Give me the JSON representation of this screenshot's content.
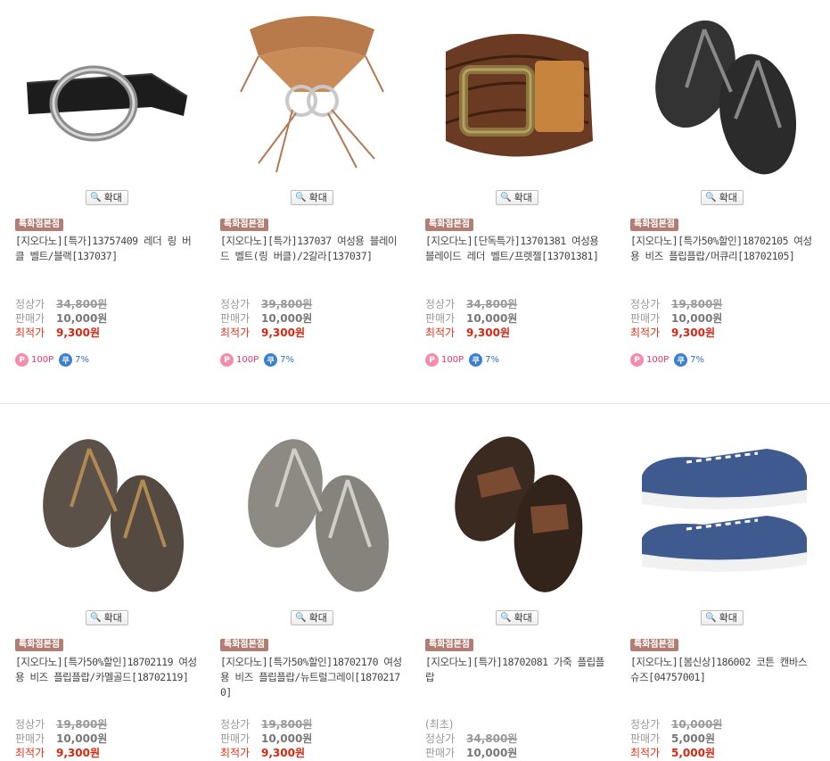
{
  "colors": {
    "badge_bg": "#b27d72",
    "best_price": "#d52711",
    "point": "#f48cac",
    "coupon": "#3b7fd0"
  },
  "labels": {
    "zoom": "확대",
    "regular_price": "정상가",
    "sale_price": "판매가",
    "best_price": "최적가",
    "store_badge": "특화점본점"
  },
  "products": [
    {
      "image": "black-oval-buckle-belt",
      "name": "[지오다노][특가]13757409 레더 링 버클 벨트/블랙[137037]",
      "note": "",
      "regular": "34,800원",
      "sale": "10,000원",
      "best": "9,300원",
      "point": "100P",
      "coupon": "7%"
    },
    {
      "image": "braided-ring-belt-tan",
      "name": "[지오다노][특가]137037 여성용 블레이드 벨트(링 버클)/2갈라[137037]",
      "note": "",
      "regular": "39,800원",
      "sale": "10,000원",
      "best": "9,300원",
      "point": "100P",
      "coupon": "7%"
    },
    {
      "image": "braided-leather-belt-brown",
      "name": "[지오다노][단독특가]13701381 여성용 블레이드 레더 벨트/프렛젤[13701381]",
      "note": "",
      "regular": "34,800원",
      "sale": "10,000원",
      "best": "9,300원",
      "point": "100P",
      "coupon": "7%"
    },
    {
      "image": "mercury-beads-flip-flop",
      "name": "[지오다노][특가50%할인]18702105 여성용 비즈 플립플랍/머큐리[18702105]",
      "note": "",
      "regular": "19,800원",
      "sale": "10,000원",
      "best": "9,300원",
      "point": "100P",
      "coupon": "7%"
    },
    {
      "image": "caramel-gold-beads-flip-flop",
      "name": "[지오다노][특가50%할인]18702119 여성용 비즈 플립플랍/카멜골드[18702119]",
      "note": "",
      "regular": "19,800원",
      "sale": "10,000원",
      "best": "9,300원"
    },
    {
      "image": "neutral-gray-beads-flip-flop",
      "name": "[지오다노][특가50%할인]18702170 여성용 비즈 플립플랍/뉴트럴그레이[18702170]",
      "note": "",
      "regular": "19,800원",
      "sale": "10,000원",
      "best": "9,300원"
    },
    {
      "image": "brown-leather-flip-flop",
      "name": "[지오다노][특가]18702081 가죽 플립플랍",
      "note": "(최초)",
      "regular": "34,800원",
      "sale": "10,000원",
      "best": ""
    },
    {
      "image": "blue-canvas-sneakers",
      "name": "[지오다노][봄신상]186002 코튼 캔바스 슈즈[04757001]",
      "note": "",
      "regular": "10,000원",
      "sale": "5,000원",
      "best": "5,000원"
    }
  ]
}
